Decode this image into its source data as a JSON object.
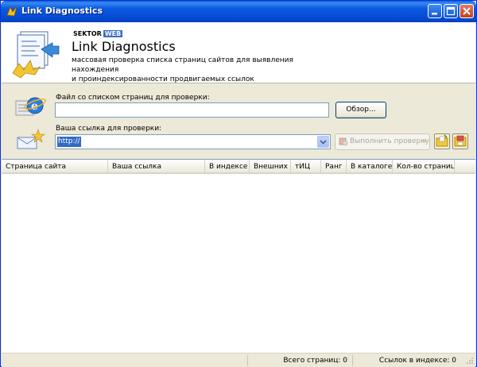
{
  "window": {
    "title": "Link Diagnostics",
    "accent": "#0a5fdb"
  },
  "header": {
    "brand_sektor": "SEKTOR",
    "brand_web": "WEB",
    "title": "Link Diagnostics",
    "subtitle_line1": "массовая проверка списка страниц сайтов для выявления нахождения",
    "subtitle_line2": "и проиндексированности продвигаемых ссылок"
  },
  "form": {
    "file_label": "Файл со списком страниц для проверки:",
    "file_value": "",
    "browse_label": "Обзор...",
    "link_label": "Ваша ссылка для проверки:",
    "link_value": "http://",
    "run_label": "Выполнить проверку",
    "run_arrow": "»"
  },
  "table": {
    "columns": [
      "Страница сайта",
      "Ваша ссылка",
      "В индексе",
      "Внешних",
      "тИЦ",
      "Ранг",
      "В каталоге",
      "Кол-во страниц"
    ],
    "rows": []
  },
  "status": {
    "total_pages": "Всего страниц: 0",
    "links_indexed": "Ссылок в индексе: 0"
  }
}
